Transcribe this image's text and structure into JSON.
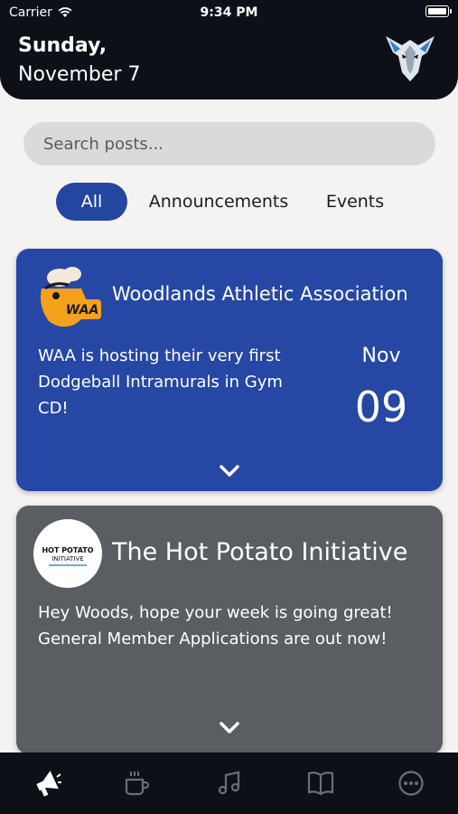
{
  "status_bar": {
    "carrier": "Carrier",
    "time": "9:34 PM"
  },
  "header": {
    "day": "Sunday,",
    "date": "November 7",
    "logo_icon": "wolf-logo-icon"
  },
  "search": {
    "placeholder": "Search posts..."
  },
  "tabs": [
    {
      "label": "All",
      "selected": true
    },
    {
      "label": "Announcements",
      "selected": false
    },
    {
      "label": "Events",
      "selected": false
    }
  ],
  "posts": [
    {
      "org": "Woodlands Athletic Association",
      "logo_text": "WAA",
      "text": "WAA is hosting their very first Dodgeball Intramurals in Gym CD!",
      "month": "Nov",
      "day": "09",
      "color": "#2647a3"
    },
    {
      "org": "The Hot Potato Initiative",
      "logo_text": "HOT POTATO INITIATIVE",
      "text": "Hey Woods, hope your week is going great! General Member Applications are out now!",
      "color": "#5a5e62"
    }
  ],
  "bottom_nav": [
    {
      "icon": "megaphone-icon",
      "active": true
    },
    {
      "icon": "coffee-cup-icon",
      "active": false
    },
    {
      "icon": "music-note-icon",
      "active": false
    },
    {
      "icon": "book-icon",
      "active": false
    },
    {
      "icon": "more-icon",
      "active": false
    }
  ],
  "colors": {
    "accent": "#2446a0",
    "header_bg": "#0d1117",
    "page_bg": "#f4f3f1"
  }
}
